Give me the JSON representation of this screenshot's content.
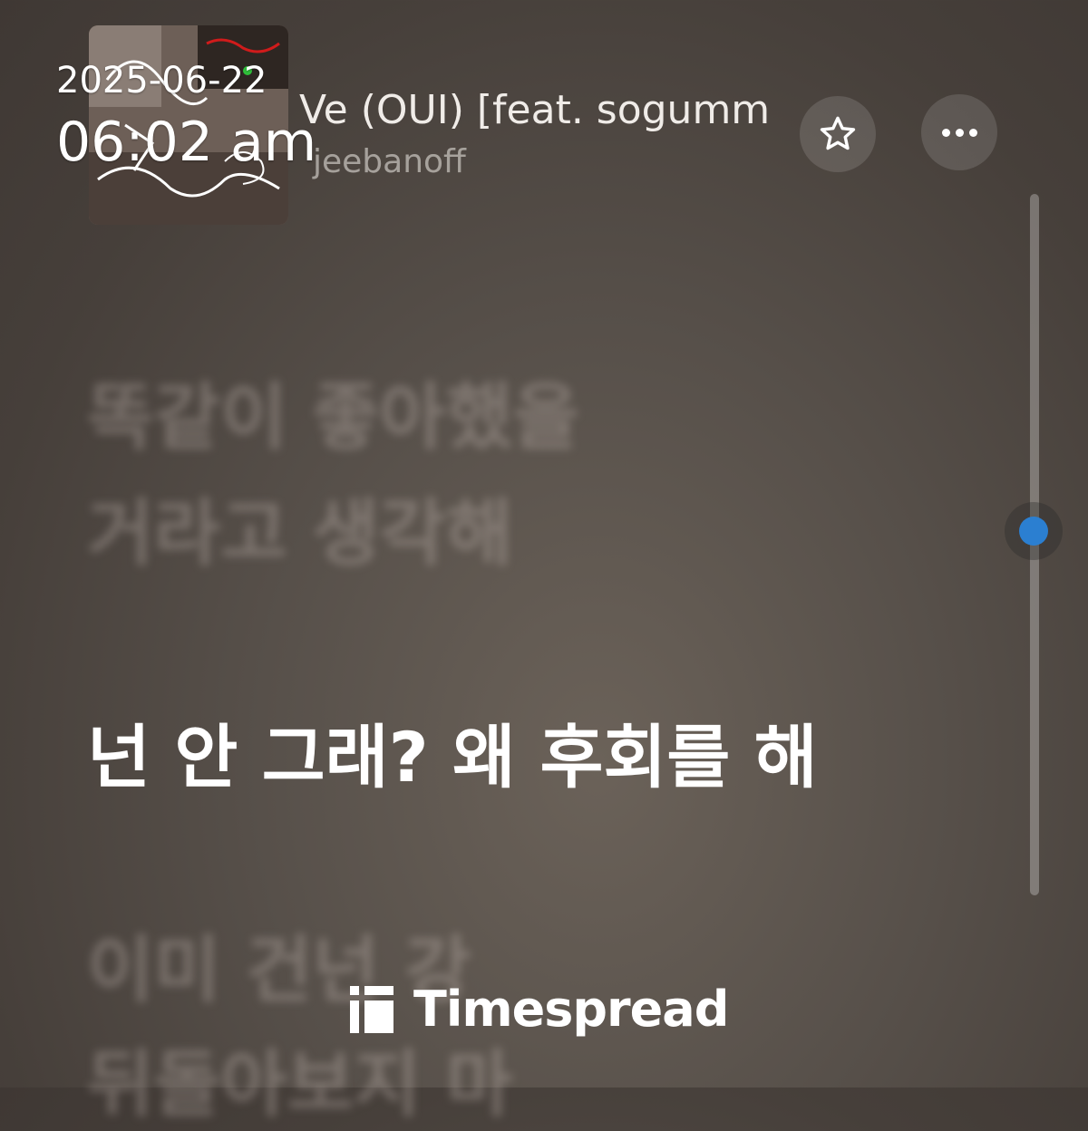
{
  "now_playing": {
    "title": "Ve (OUI) [feat. sogumm",
    "artist": "jeebanoff",
    "favorite_icon": "star-icon",
    "more_icon": "more-dots-icon"
  },
  "timestamp": {
    "date": "2025-06-22",
    "time": "06:02 am"
  },
  "lyrics": [
    {
      "text": "똑같이 좋아했을",
      "state": "past"
    },
    {
      "text": "거라고 생각해",
      "state": "past"
    },
    {
      "text": "넌 안 그래? 왜 후회를 해",
      "state": "current"
    },
    {
      "text": "이미 건넌 강",
      "state": "upcoming"
    },
    {
      "text": "뒤돌아보지 마",
      "state": "upcoming"
    }
  ],
  "scroll": {
    "position_fraction": 0.48
  },
  "watermark": {
    "brand": "Timespread",
    "icon": "timespread-logo-icon"
  },
  "colors": {
    "accent": "#2b7fd1",
    "background": "#57504a"
  }
}
